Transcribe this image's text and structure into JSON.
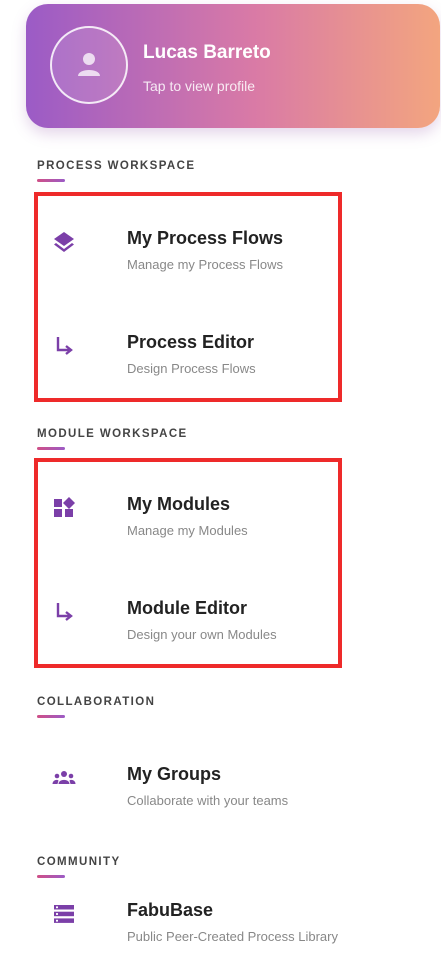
{
  "profile": {
    "name": "Lucas Barreto",
    "subtitle": "Tap to view profile"
  },
  "sections": {
    "process": {
      "title": "PROCESS WORKSPACE",
      "items": [
        {
          "label": "My Process Flows",
          "sub": "Manage my Process Flows",
          "icon": "layers-icon"
        },
        {
          "label": "Process Editor",
          "sub": "Design Process Flows",
          "icon": "subdirectory-arrow-icon"
        }
      ]
    },
    "module": {
      "title": "MODULE WORKSPACE",
      "items": [
        {
          "label": "My Modules",
          "sub": "Manage my Modules",
          "icon": "widgets-icon"
        },
        {
          "label": "Module Editor",
          "sub": "Design your own Modules",
          "icon": "subdirectory-arrow-icon"
        }
      ]
    },
    "collaboration": {
      "title": "COLLABORATION",
      "items": [
        {
          "label": "My Groups",
          "sub": "Collaborate with your teams",
          "icon": "groups-icon"
        }
      ]
    },
    "community": {
      "title": "COMMUNITY",
      "items": [
        {
          "label": "FabuBase",
          "sub": "Public Peer-Created Process Library",
          "icon": "storage-icon"
        }
      ]
    }
  },
  "colors": {
    "icon": "#7b3fa8",
    "highlight": "#ee2a2a",
    "gradient_start": "#9b5bc6",
    "gradient_end": "#f3a57f"
  }
}
